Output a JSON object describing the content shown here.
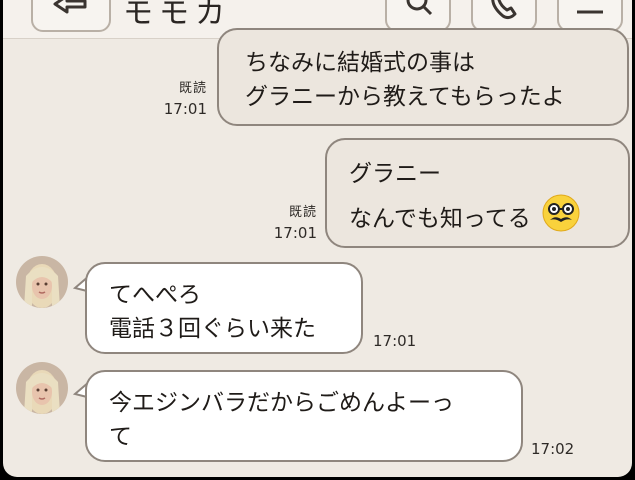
{
  "header": {
    "contact_name": "モモカ"
  },
  "messages": [
    {
      "sender": "me",
      "lines": [
        "ちなみに結婚式の事は",
        "グラニーから教えてもらったよ"
      ],
      "read": "既読",
      "time": "17:01"
    },
    {
      "sender": "me",
      "lines": [
        "グラニー",
        "なんでも知ってる"
      ],
      "emoji": "nerd-face-mustache-icon",
      "read": "既読",
      "time": "17:01"
    },
    {
      "sender": "them",
      "lines": [
        "てへぺろ",
        "電話３回ぐらい来た"
      ],
      "time": "17:01"
    },
    {
      "sender": "them",
      "lines": [
        "今エジンバラだからごめんよーっ",
        "て"
      ],
      "time": "17:02"
    }
  ],
  "colors": {
    "background": "#efeae3",
    "bubble_me": "#ece6de",
    "bubble_them": "#ffffff",
    "bubble_border": "#8f867e"
  }
}
